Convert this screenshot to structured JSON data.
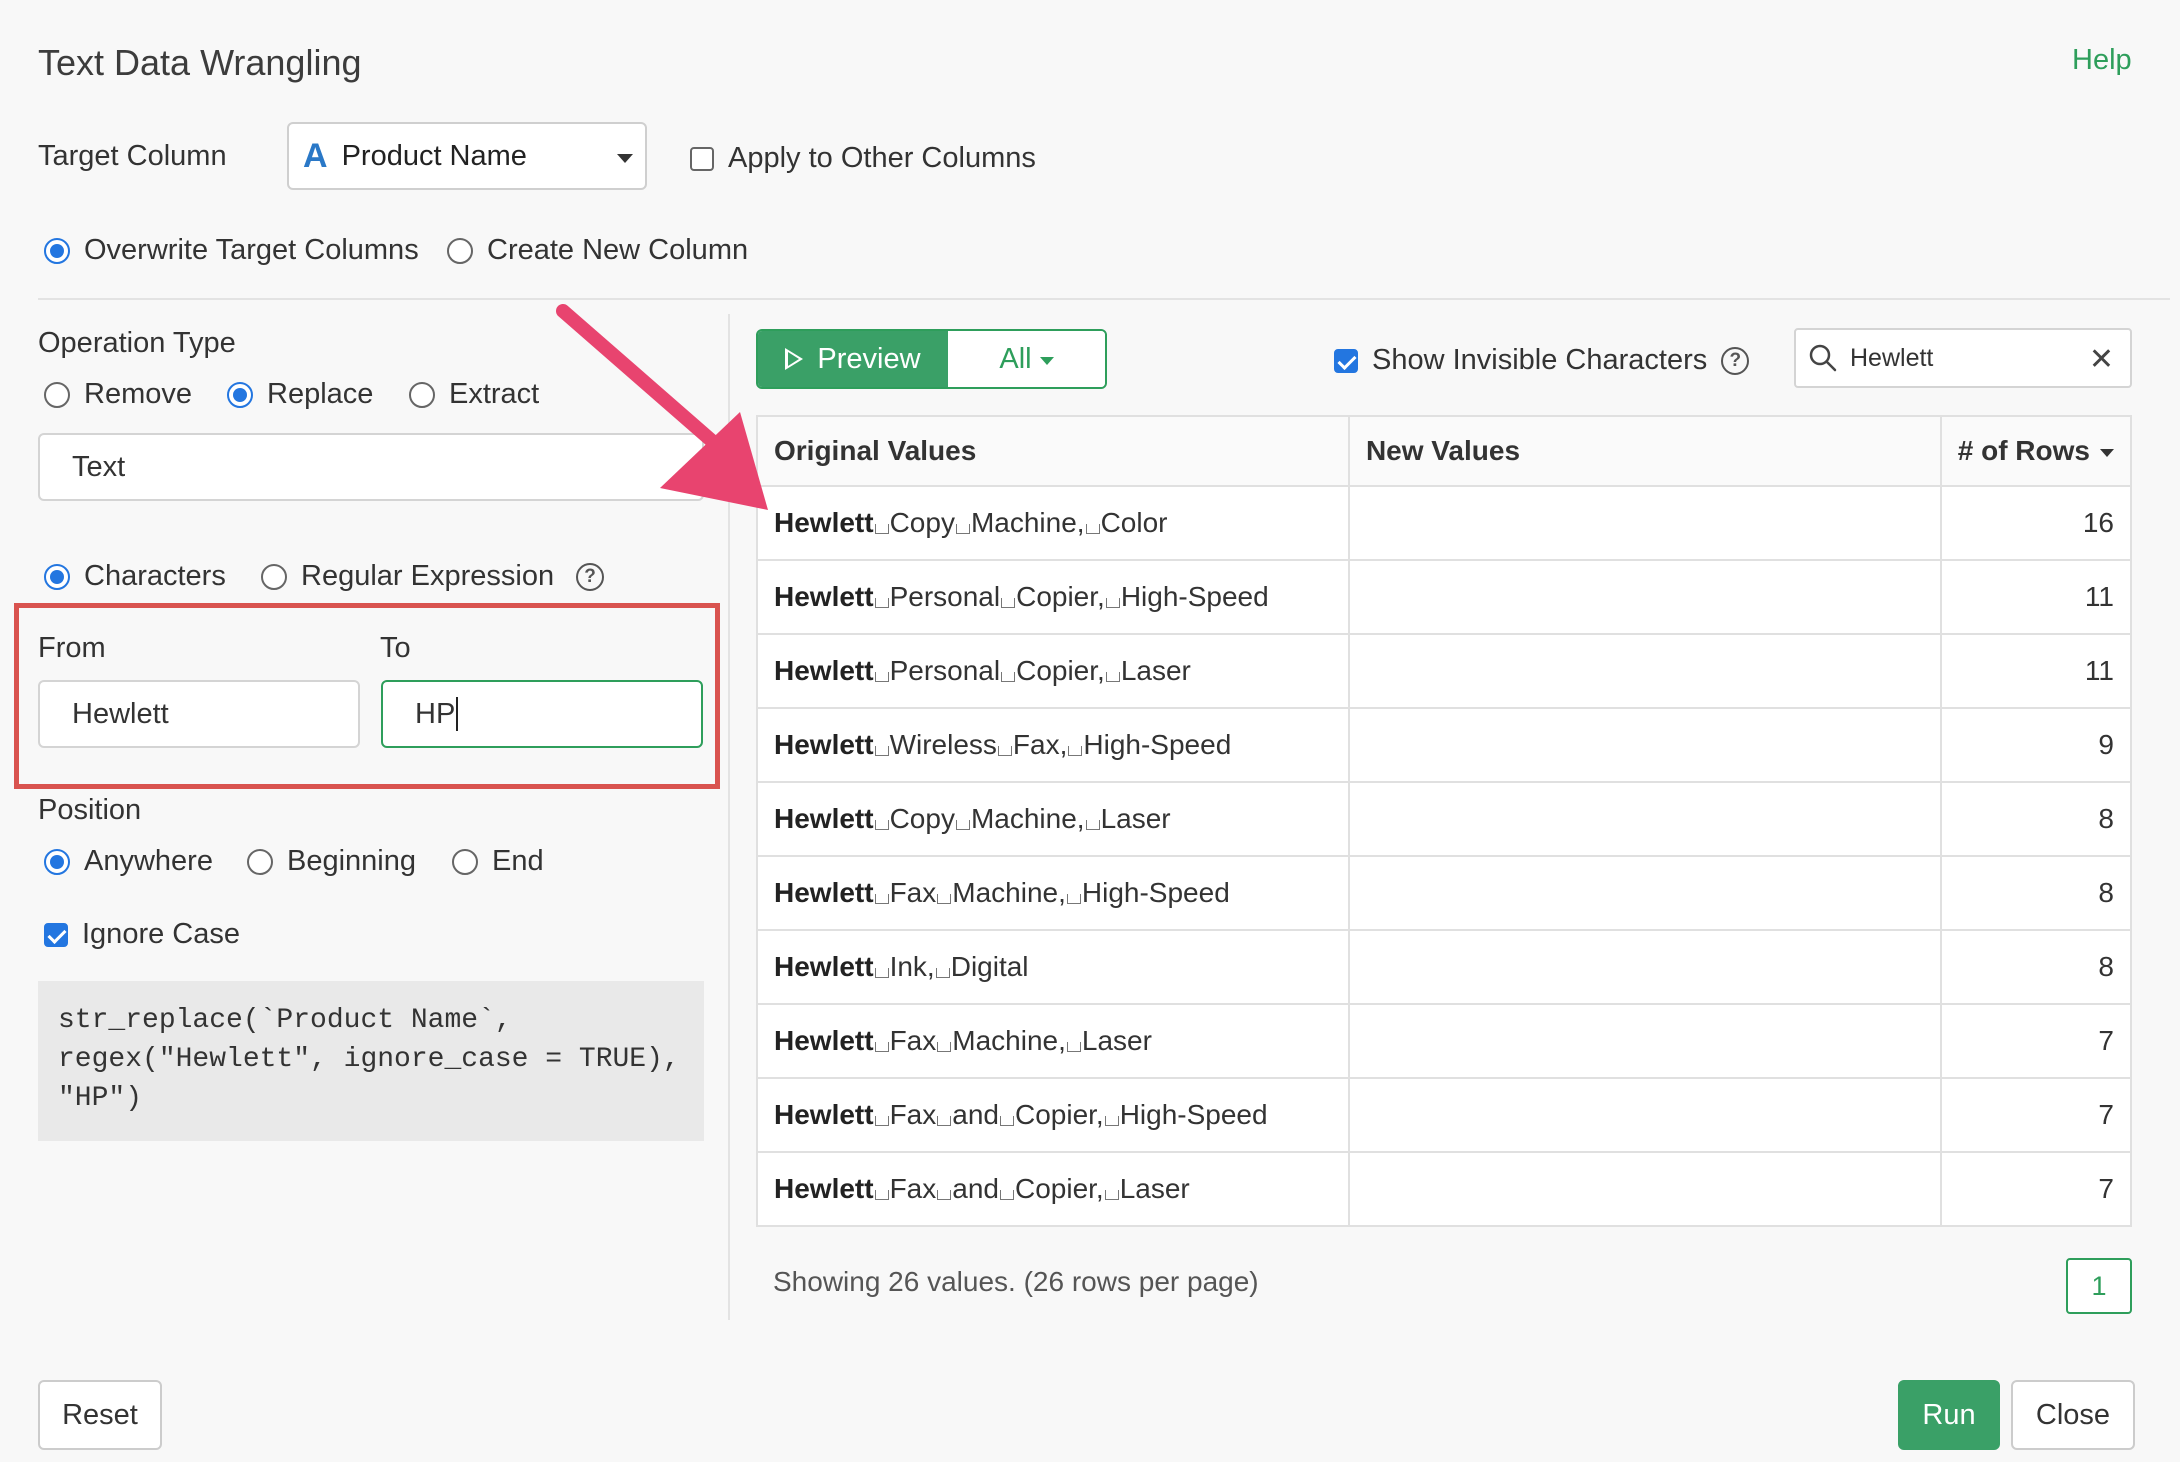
{
  "dialog": {
    "title": "Text Data Wrangling",
    "help_label": "Help"
  },
  "target": {
    "label": "Target Column",
    "column_type_icon": "A",
    "column_value": "Product Name",
    "apply_other_label": "Apply to Other Columns",
    "apply_other_checked": false
  },
  "output_mode": {
    "overwrite_label": "Overwrite Target Columns",
    "create_new_label": "Create New Column",
    "selected": "overwrite"
  },
  "operation": {
    "label": "Operation Type",
    "remove_label": "Remove",
    "replace_label": "Replace",
    "extract_label": "Extract",
    "selected": "replace",
    "text_type_value": "Text",
    "characters_label": "Characters",
    "regex_label": "Regular Expression",
    "match_selected": "characters"
  },
  "replace": {
    "from_label": "From",
    "to_label": "To",
    "from_value": "Hewlett",
    "to_value": "HP"
  },
  "position": {
    "label": "Position",
    "anywhere_label": "Anywhere",
    "beginning_label": "Beginning",
    "end_label": "End",
    "selected": "anywhere"
  },
  "ignore_case": {
    "label": "Ignore Case",
    "checked": true
  },
  "code": {
    "line1": "str_replace(`Product Name`,",
    "line2": "regex(\"Hewlett\", ignore_case = TRUE),",
    "line3": "\"HP\")"
  },
  "preview": {
    "preview_label": "Preview",
    "filter_label": "All",
    "show_invisible_label": "Show Invisible Characters",
    "show_invisible_checked": true,
    "search_value": "Hewlett"
  },
  "table": {
    "headers": [
      "Original Values",
      "New Values",
      "# of Rows"
    ],
    "rows": [
      {
        "match": "Hewlett",
        "words": [
          "Copy",
          "Machine,",
          "Color"
        ],
        "new": "",
        "count": "16"
      },
      {
        "match": "Hewlett",
        "words": [
          "Personal",
          "Copier,",
          "High-Speed"
        ],
        "new": "",
        "count": "11"
      },
      {
        "match": "Hewlett",
        "words": [
          "Personal",
          "Copier,",
          "Laser"
        ],
        "new": "",
        "count": "11"
      },
      {
        "match": "Hewlett",
        "words": [
          "Wireless",
          "Fax,",
          "High-Speed"
        ],
        "new": "",
        "count": "9"
      },
      {
        "match": "Hewlett",
        "words": [
          "Copy",
          "Machine,",
          "Laser"
        ],
        "new": "",
        "count": "8"
      },
      {
        "match": "Hewlett",
        "words": [
          "Fax",
          "Machine,",
          "High-Speed"
        ],
        "new": "",
        "count": "8"
      },
      {
        "match": "Hewlett",
        "words": [
          "Ink,",
          "Digital"
        ],
        "new": "",
        "count": "8"
      },
      {
        "match": "Hewlett",
        "words": [
          "Fax",
          "Machine,",
          "Laser"
        ],
        "new": "",
        "count": "7"
      },
      {
        "match": "Hewlett",
        "words": [
          "Fax",
          "and",
          "Copier,",
          "High-Speed"
        ],
        "new": "",
        "count": "7"
      },
      {
        "match": "Hewlett",
        "words": [
          "Fax",
          "and",
          "Copier,",
          "Laser"
        ],
        "new": "",
        "count": "7"
      }
    ],
    "status": "Showing 26 values. (26 rows per page)",
    "page": "1"
  },
  "footer": {
    "reset_label": "Reset",
    "run_label": "Run",
    "close_label": "Close"
  },
  "colors": {
    "accent_green": "#3aa067",
    "radio_blue": "#2376e0",
    "highlight_red": "#d9534f",
    "arrow_pink": "#e8446f"
  }
}
